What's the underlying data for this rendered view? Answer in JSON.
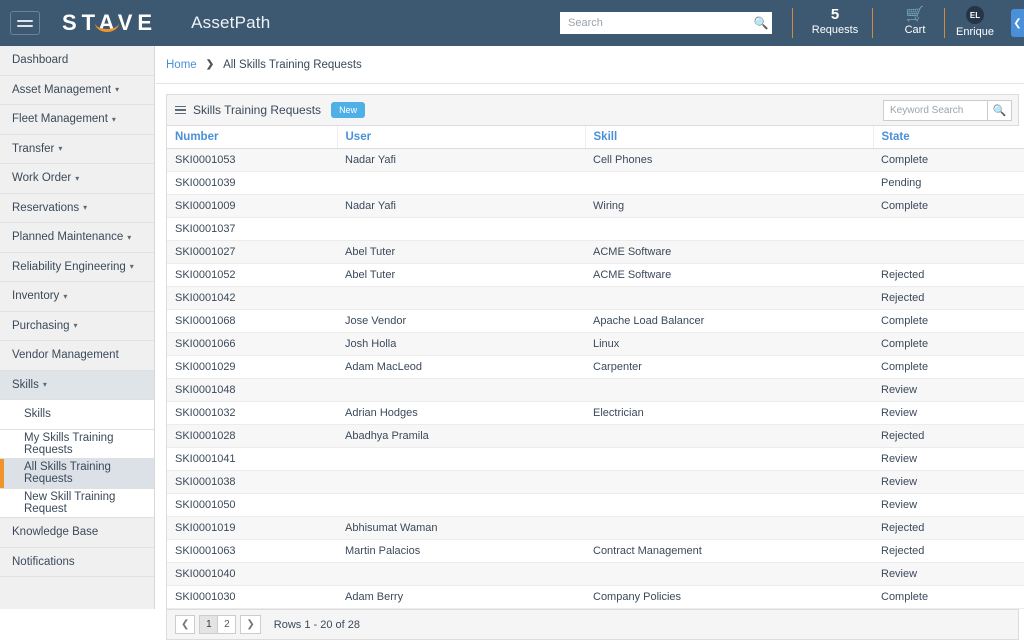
{
  "header": {
    "menu_icon": "hamburger-icon",
    "brand": "STAVE",
    "app_title": "AssetPath",
    "search_placeholder": "Search",
    "search_value": "",
    "search_icon": "search-icon",
    "requests_count": "5",
    "requests_label": "Requests",
    "cart_icon": "cart-icon",
    "cart_label": "Cart",
    "user_initials": "EL",
    "user_name": "Enrique",
    "collapse_icon": "chevron-left-icon",
    "bar_color": "#3d5871",
    "accent_color": "#f0932b"
  },
  "sidebar": {
    "items": [
      {
        "label": "Dashboard",
        "caret": "",
        "level": 0,
        "state": ""
      },
      {
        "label": "Asset Management",
        "caret": "▾",
        "level": 0,
        "state": ""
      },
      {
        "label": "Fleet Management",
        "caret": "▾",
        "level": 0,
        "state": ""
      },
      {
        "label": "Transfer",
        "caret": "▾",
        "level": 0,
        "state": ""
      },
      {
        "label": "Work Order",
        "caret": "▾",
        "level": 0,
        "state": ""
      },
      {
        "label": "Reservations",
        "caret": "▾",
        "level": 0,
        "state": ""
      },
      {
        "label": "Planned Maintenance",
        "caret": "▾",
        "level": 0,
        "state": ""
      },
      {
        "label": "Reliability Engineering",
        "caret": "▾",
        "level": 0,
        "state": ""
      },
      {
        "label": "Inventory",
        "caret": "▾",
        "level": 0,
        "state": ""
      },
      {
        "label": "Purchasing",
        "caret": "▾",
        "level": 0,
        "state": ""
      },
      {
        "label": "Vendor Management",
        "caret": "",
        "level": 0,
        "state": ""
      },
      {
        "label": "Skills",
        "caret": "▾",
        "level": 0,
        "state": "expanded"
      },
      {
        "label": "Skills",
        "caret": "",
        "level": 1,
        "state": ""
      },
      {
        "label": "My Skills Training Requests",
        "caret": "",
        "level": 1,
        "state": ""
      },
      {
        "label": "All Skills Training Requests",
        "caret": "",
        "level": 1,
        "state": "active"
      },
      {
        "label": "New Skill Training Request",
        "caret": "",
        "level": 1,
        "state": ""
      },
      {
        "label": "Knowledge Base",
        "caret": "",
        "level": 0,
        "state": ""
      },
      {
        "label": "Notifications",
        "caret": "",
        "level": 0,
        "state": ""
      }
    ]
  },
  "breadcrumb": {
    "home": "Home",
    "separator": "❯",
    "current": "All Skills Training Requests"
  },
  "panel": {
    "list_icon": "list-icon",
    "title": "Skills Training Requests",
    "new_button": "New",
    "keyword_placeholder": "Keyword Search",
    "keyword_value": "",
    "keyword_icon": "search-icon"
  },
  "table": {
    "columns": [
      "Number",
      "User",
      "Skill",
      "State"
    ],
    "rows": [
      {
        "number": "SKI0001053",
        "user": "Nadar Yafi",
        "skill": "Cell Phones",
        "state": "Complete"
      },
      {
        "number": "SKI0001039",
        "user": "",
        "skill": "",
        "state": "Pending"
      },
      {
        "number": "SKI0001009",
        "user": "Nadar Yafi",
        "skill": "Wiring",
        "state": "Complete"
      },
      {
        "number": "SKI0001037",
        "user": "",
        "skill": "",
        "state": ""
      },
      {
        "number": "SKI0001027",
        "user": "Abel Tuter",
        "skill": "ACME Software",
        "state": ""
      },
      {
        "number": "SKI0001052",
        "user": "Abel Tuter",
        "skill": "ACME Software",
        "state": "Rejected"
      },
      {
        "number": "SKI0001042",
        "user": "",
        "skill": "",
        "state": "Rejected"
      },
      {
        "number": "SKI0001068",
        "user": "Jose Vendor",
        "skill": "Apache Load Balancer",
        "state": "Complete"
      },
      {
        "number": "SKI0001066",
        "user": "Josh Holla",
        "skill": "Linux",
        "state": "Complete"
      },
      {
        "number": "SKI0001029",
        "user": "Adam MacLeod",
        "skill": "Carpenter",
        "state": "Complete"
      },
      {
        "number": "SKI0001048",
        "user": "",
        "skill": "",
        "state": "Review"
      },
      {
        "number": "SKI0001032",
        "user": "Adrian Hodges",
        "skill": "Electrician",
        "state": "Review"
      },
      {
        "number": "SKI0001028",
        "user": "Abadhya Pramila",
        "skill": "",
        "state": "Rejected"
      },
      {
        "number": "SKI0001041",
        "user": "",
        "skill": "",
        "state": "Review"
      },
      {
        "number": "SKI0001038",
        "user": "",
        "skill": "",
        "state": "Review"
      },
      {
        "number": "SKI0001050",
        "user": "",
        "skill": "",
        "state": "Review"
      },
      {
        "number": "SKI0001019",
        "user": "Abhisumat Waman",
        "skill": "",
        "state": "Rejected"
      },
      {
        "number": "SKI0001063",
        "user": "Martin Palacios",
        "skill": "Contract Management",
        "state": "Rejected"
      },
      {
        "number": "SKI0001040",
        "user": "",
        "skill": "",
        "state": "Review"
      },
      {
        "number": "SKI0001030",
        "user": "Adam Berry",
        "skill": "Company Policies",
        "state": "Complete"
      }
    ]
  },
  "pagination": {
    "prev_icon": "chevron-left-icon",
    "next_icon": "chevron-right-icon",
    "pages": [
      "1",
      "2"
    ],
    "current_page": "1",
    "rows_label": "Rows 1 - 20 of 28"
  }
}
